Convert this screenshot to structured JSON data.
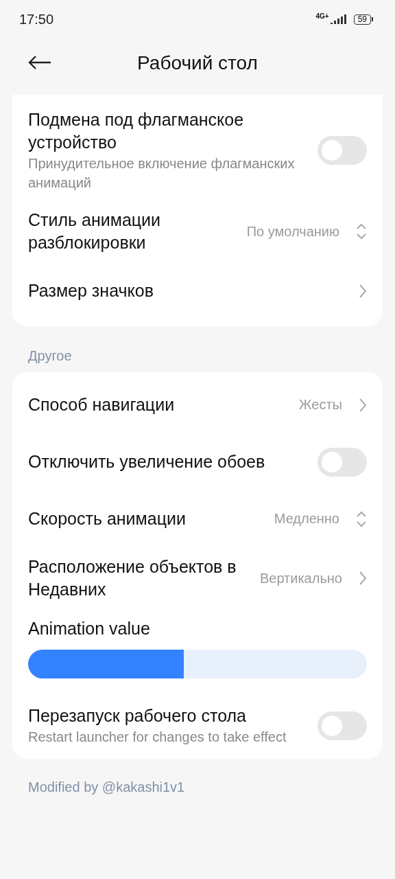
{
  "status_bar": {
    "time": "17:50",
    "network": "4G+",
    "battery": "59"
  },
  "header": {
    "title": "Рабочий стол"
  },
  "sections": [
    {
      "items": [
        {
          "kind": "toggle",
          "title": "Подмена под флагманское устройство",
          "subtitle": "Принудительное включение флагманских анимаций",
          "on": false
        },
        {
          "kind": "select",
          "title": "Стиль анимации разблокировки",
          "value": "По умолчанию"
        },
        {
          "kind": "link",
          "title": "Размер значков"
        }
      ]
    },
    {
      "header": "Другое",
      "items": [
        {
          "kind": "link",
          "title": "Способ навигации",
          "value": "Жесты"
        },
        {
          "kind": "toggle",
          "title": "Отключить увеличение обоев",
          "on": false
        },
        {
          "kind": "select",
          "title": "Скорость анимации",
          "value": "Медленно"
        },
        {
          "kind": "link",
          "title": "Расположение объектов в Недавних",
          "value": "Вертикально"
        },
        {
          "kind": "slider",
          "title": "Animation value",
          "level": 0.46
        },
        {
          "kind": "toggle",
          "title": "Перезапуск рабочего стола",
          "subtitle": "Restart launcher for changes to take effect",
          "on": false
        }
      ]
    }
  ],
  "footer": "Modified by @kakashi1v1"
}
